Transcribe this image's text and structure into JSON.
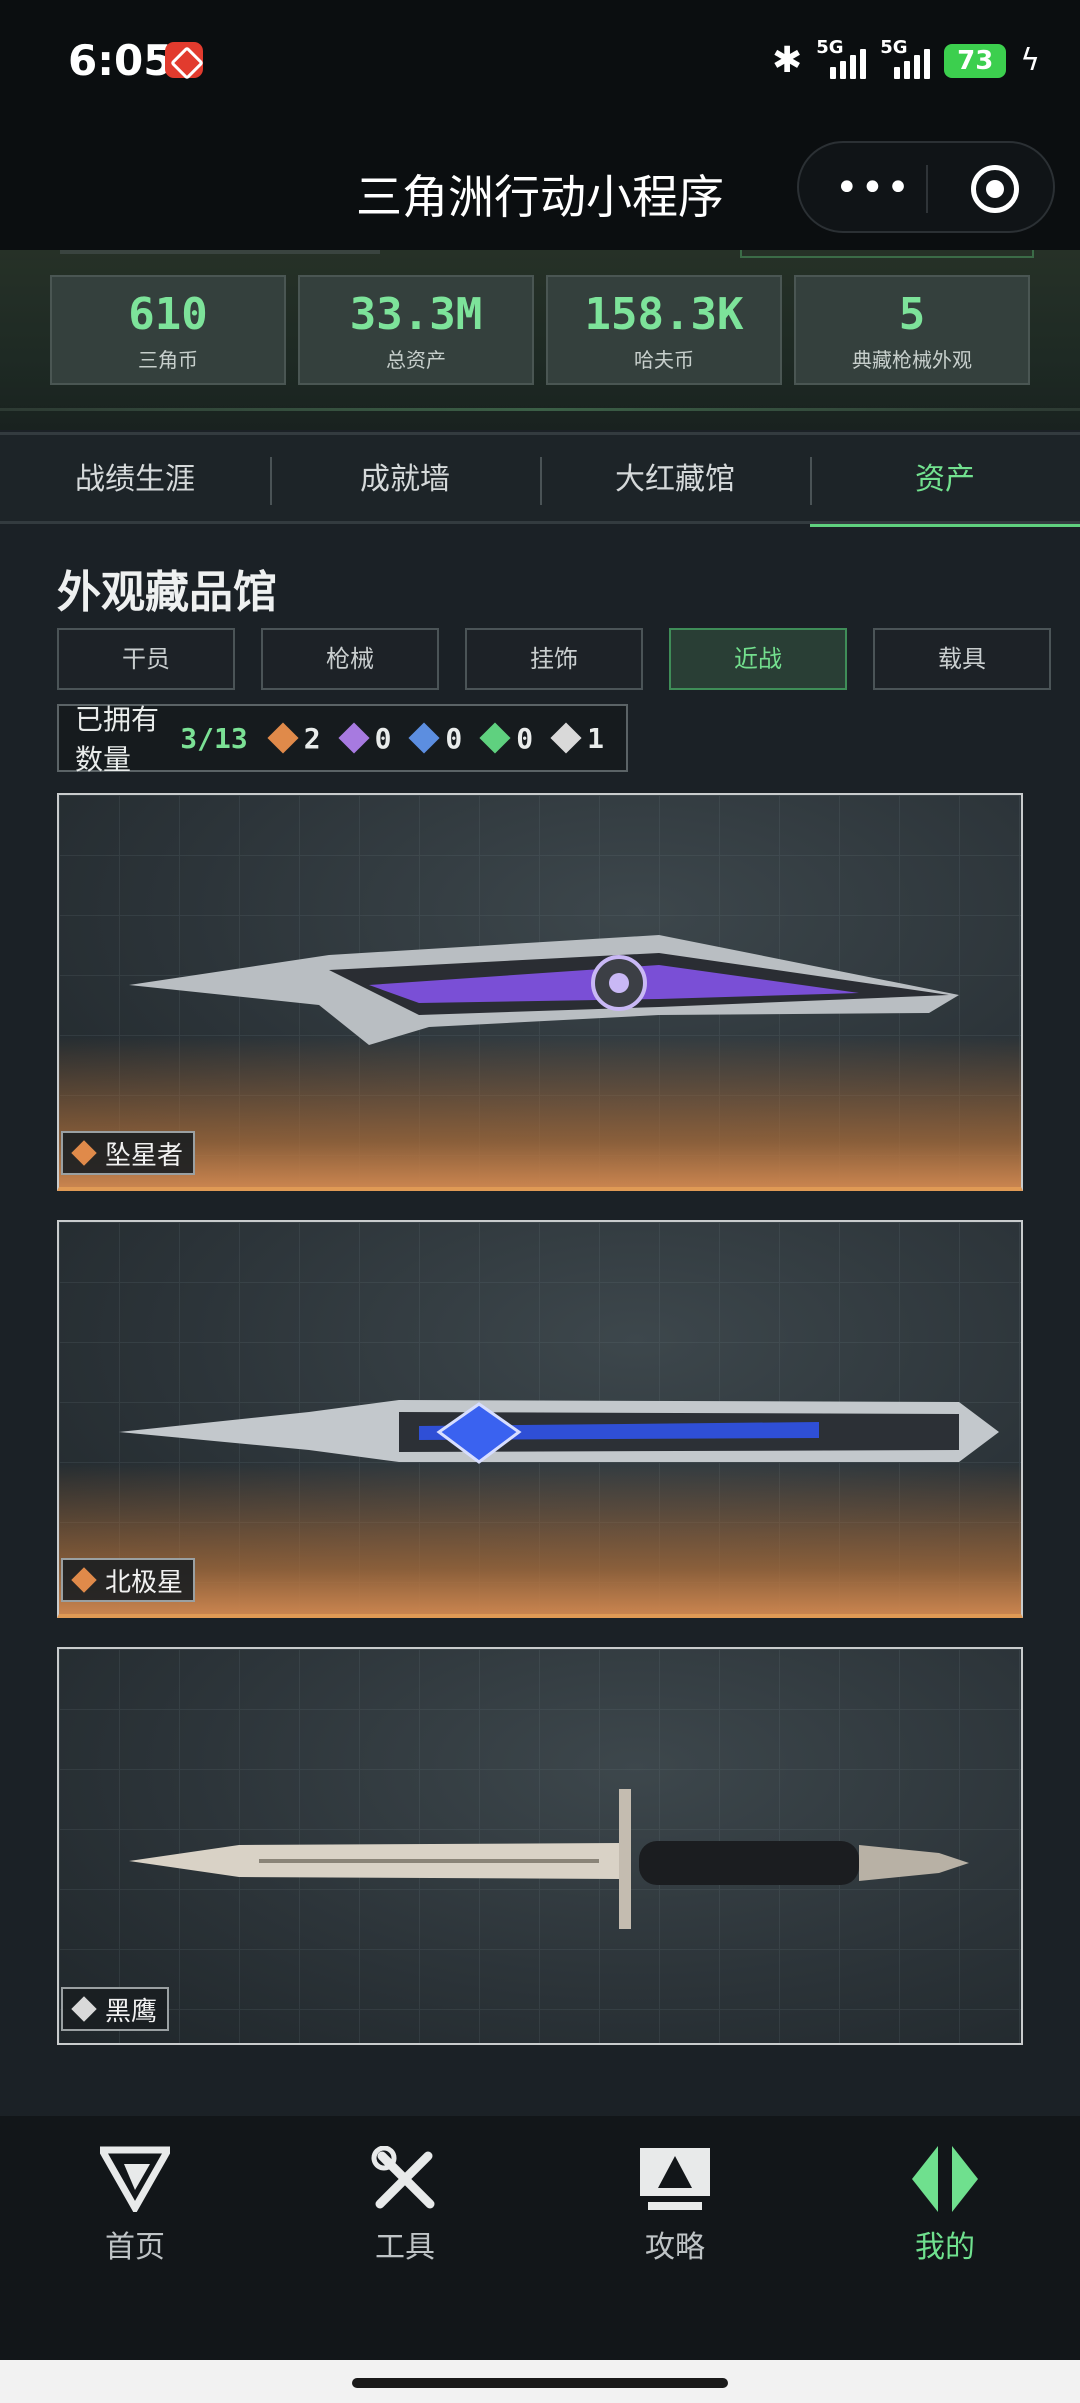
{
  "status_bar": {
    "time": "6:05",
    "signal1": "5G",
    "signal2": "5G",
    "battery": "73"
  },
  "header": {
    "title": "三角洲行动小程序",
    "more_label": "•••"
  },
  "stats": [
    {
      "value": "610",
      "label": "三角币"
    },
    {
      "value": "33.3M",
      "label": "总资产"
    },
    {
      "value": "158.3K",
      "label": "哈夫币"
    },
    {
      "value": "5",
      "label": "典藏枪械外观"
    }
  ],
  "tabs": [
    {
      "label": "战绩生涯"
    },
    {
      "label": "成就墙"
    },
    {
      "label": "大红藏馆"
    },
    {
      "label": "资产",
      "active": true
    }
  ],
  "section_title": "外观藏品馆",
  "categories": [
    {
      "label": "干员"
    },
    {
      "label": "枪械"
    },
    {
      "label": "挂饰"
    },
    {
      "label": "近战",
      "active": true
    },
    {
      "label": "载具"
    }
  ],
  "owned": {
    "label": "已拥有数量",
    "count": "3/13",
    "rarities": [
      {
        "color": "#e08a4a",
        "value": "2"
      },
      {
        "color": "#a77ae0",
        "value": "0"
      },
      {
        "color": "#5c8ee0",
        "value": "0"
      },
      {
        "color": "#5fd17f",
        "value": "0"
      },
      {
        "color": "#d9d9d9",
        "value": "1"
      }
    ]
  },
  "items": [
    {
      "name": "坠星者",
      "rarity_color": "#e08a4a"
    },
    {
      "name": "北极星",
      "rarity_color": "#e08a4a"
    },
    {
      "name": "黑鹰",
      "rarity_color": "#d9d9d9"
    }
  ],
  "bottom_nav": [
    {
      "label": "首页"
    },
    {
      "label": "工具"
    },
    {
      "label": "攻略"
    },
    {
      "label": "我的",
      "active": true
    }
  ],
  "colors": {
    "accent": "#6fe08e",
    "orange_rarity": "#e08a4a"
  }
}
